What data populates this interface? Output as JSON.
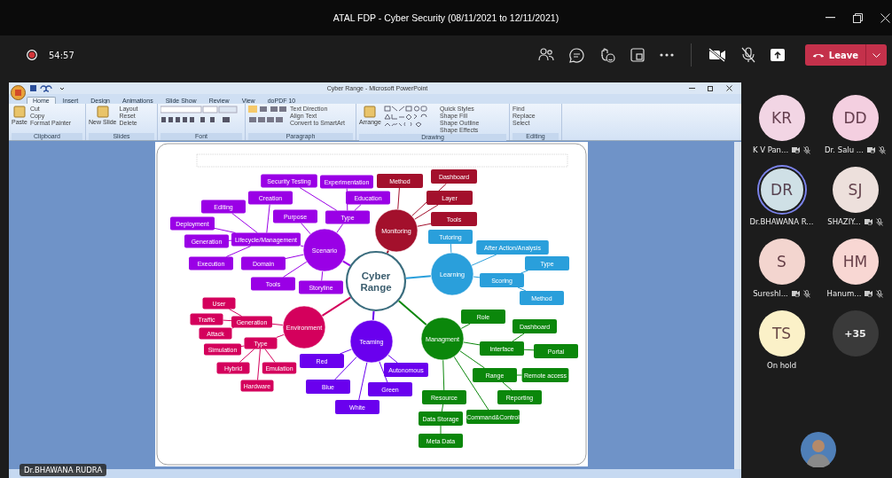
{
  "window": {
    "title": "ATAL FDP - Cyber Security (08/11/2021 to 12/11/2021)"
  },
  "meeting": {
    "recording": true,
    "elapsed": "54:57",
    "leave_label": "Leave"
  },
  "shared_screen": {
    "presenter": "Dr.BHAWANA RUDRA",
    "app": {
      "title": "Cyber Range - Microsoft PowerPoint",
      "tabs": [
        {
          "label": "Home",
          "selected": true
        },
        {
          "label": "Insert",
          "selected": false
        },
        {
          "label": "Design",
          "selected": false
        },
        {
          "label": "Animations",
          "selected": false
        },
        {
          "label": "Slide Show",
          "selected": false
        },
        {
          "label": "Review",
          "selected": false
        },
        {
          "label": "View",
          "selected": false
        },
        {
          "label": "doPDF 10",
          "selected": false
        }
      ],
      "ribbon_groups": [
        {
          "label": "Clipboard",
          "big": "Paste",
          "items": [
            "Cut",
            "Copy",
            "Format Painter"
          ]
        },
        {
          "label": "Slides",
          "big": "New Slide",
          "items": [
            "Layout",
            "Reset",
            "Delete"
          ]
        },
        {
          "label": "Font"
        },
        {
          "label": "Paragraph",
          "items": [
            "Text Direction",
            "Align Text",
            "Convert to SmartArt"
          ]
        },
        {
          "label": "Drawing",
          "big": "Arrange",
          "items": [
            "Quick Styles",
            "Shape Fill",
            "Shape Outline",
            "Shape Effects"
          ]
        },
        {
          "label": "Editing",
          "items": [
            "Find",
            "Replace",
            "Select"
          ]
        }
      ]
    },
    "mindmap": {
      "center": "Cyber Range",
      "branches": [
        {
          "label": "Scenario",
          "color": "#9a00e6",
          "children": [
            {
              "label": "Type",
              "children": [
                {
                  "label": "Security Testing"
                },
                {
                  "label": "Experimentation"
                },
                {
                  "label": "Education"
                }
              ]
            },
            {
              "label": "Purpose"
            },
            {
              "label": "Lifecycle/Management",
              "children": [
                {
                  "label": "Creation"
                },
                {
                  "label": "Editing"
                },
                {
                  "label": "Deployment"
                },
                {
                  "label": "Generation"
                },
                {
                  "label": "Execution"
                }
              ]
            },
            {
              "label": "Domain"
            },
            {
              "label": "Tools"
            },
            {
              "label": "Storyline"
            }
          ]
        },
        {
          "label": "Monitoring",
          "color": "#a3102c",
          "children": [
            {
              "label": "Method"
            },
            {
              "label": "Dashboard"
            },
            {
              "label": "Layer"
            },
            {
              "label": "Tools"
            }
          ]
        },
        {
          "label": "Learning",
          "color": "#2a9fdb",
          "children": [
            {
              "label": "Tutoring"
            },
            {
              "label": "After Action/Analysis"
            },
            {
              "label": "Scoring",
              "children": [
                {
                  "label": "Type"
                },
                {
                  "label": "Method"
                }
              ]
            }
          ]
        },
        {
          "label": "Managment",
          "color": "#0b870b",
          "children": [
            {
              "label": "Role"
            },
            {
              "label": "Interface",
              "children": [
                {
                  "label": "Dashboard"
                },
                {
                  "label": "Portal"
                }
              ]
            },
            {
              "label": "Range",
              "children": [
                {
                  "label": "Remote access"
                },
                {
                  "label": "Reporting"
                }
              ]
            },
            {
              "label": "Resource",
              "children": [
                {
                  "label": "Data Storage",
                  "children": [
                    {
                      "label": "Meta Data"
                    }
                  ]
                }
              ]
            },
            {
              "label": "Command&Control"
            }
          ]
        },
        {
          "label": "Teaming",
          "color": "#6a00ee",
          "children": [
            {
              "label": "Red"
            },
            {
              "label": "Blue"
            },
            {
              "label": "White"
            },
            {
              "label": "Green"
            },
            {
              "label": "Autonomous"
            }
          ]
        },
        {
          "label": "Environment",
          "color": "#d4005c",
          "children": [
            {
              "label": "Generation",
              "children": [
                {
                  "label": "User"
                },
                {
                  "label": "Traffic"
                },
                {
                  "label": "Attack"
                }
              ]
            },
            {
              "label": "Type",
              "children": [
                {
                  "label": "Simulation"
                },
                {
                  "label": "Hybrid"
                },
                {
                  "label": "Emulation"
                },
                {
                  "label": "Hardware"
                }
              ]
            }
          ]
        }
      ]
    }
  },
  "participants": [
    {
      "initials": "KR",
      "name": "K V Pan...",
      "color": "#f2d5e4",
      "speaking": false,
      "camera_off": true,
      "muted": true
    },
    {
      "initials": "DD",
      "name": "Dr. Salu ...",
      "color": "#f4cfe0",
      "speaking": false,
      "camera_off": true,
      "muted": true
    },
    {
      "initials": "DR",
      "name": "Dr.BHAWANA R...",
      "color": "#cfe0e6",
      "speaking": true,
      "camera_off": false,
      "muted": false
    },
    {
      "initials": "SJ",
      "name": "SHAZIY...",
      "color": "#ede0dc",
      "speaking": false,
      "camera_off": true,
      "muted": true
    },
    {
      "initials": "S",
      "name": "Sureshl...",
      "color": "#f3d5cf",
      "speaking": false,
      "camera_off": true,
      "muted": true
    },
    {
      "initials": "HM",
      "name": "Hanum...",
      "color": "#f8d7d3",
      "speaking": false,
      "camera_off": true,
      "muted": true
    },
    {
      "initials": "TS",
      "name": "On hold",
      "color": "#fbf1c8",
      "speaking": false,
      "camera_off": false,
      "muted": false
    }
  ],
  "overflow_count": "+35"
}
